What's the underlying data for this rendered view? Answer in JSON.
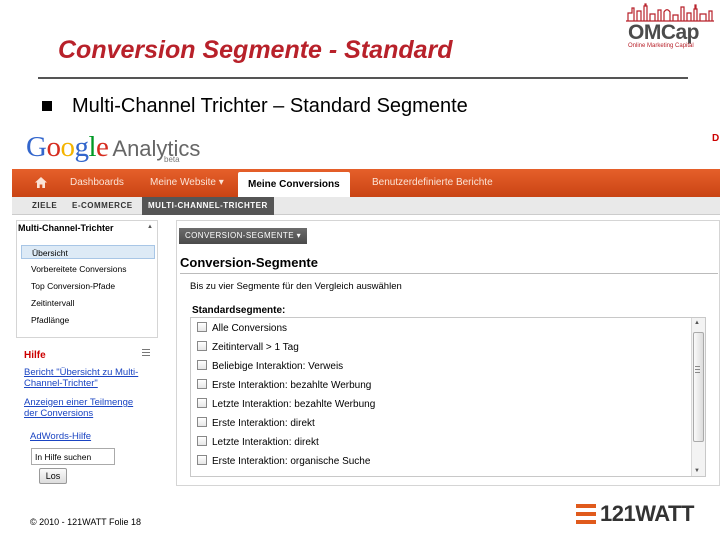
{
  "slide": {
    "title": "Conversion Segmente - Standard",
    "bullet": "Multi-Channel Trichter – Standard Segmente",
    "footer": "© 2010 - 121WATT Folie 18"
  },
  "logos": {
    "omcap_name": "OMCap",
    "omcap_tagline": "Online Marketing Capital",
    "watt": "121WATT"
  },
  "ga": {
    "google_letters": [
      "G",
      "o",
      "o",
      "g",
      "l",
      "e"
    ],
    "google_colors": [
      "#3366cc",
      "#d62d20",
      "#f4b400",
      "#3366cc",
      "#009925",
      "#d62d20"
    ],
    "analytics": "Analytics",
    "beta": "beta",
    "corner_mark": "D",
    "nav": {
      "home_icon": "home-icon",
      "dashboards": "Dashboards",
      "meine_website": "Meine Website ▾",
      "meine_conversions": "Meine Conversions",
      "benutzerdefinierte": "Benutzerdefinierte Berichte"
    },
    "subnav": {
      "ziele": "ZIELE",
      "ecommerce": "E-COMMERCE",
      "mct": "MULTI-CHANNEL-TRICHTER"
    },
    "sidebar": {
      "header": "Multi-Channel-Trichter",
      "collapse": "▲",
      "items": [
        "Übersicht",
        "Vorbereitete Conversions",
        "Top Conversion-Pfade",
        "Zeitintervall",
        "Pfadlänge"
      ]
    },
    "help": {
      "title": "Hilfe",
      "link1_line1": "Bericht \"Übersicht zu Multi-",
      "link1_line2": "Channel-Trichter\"",
      "link2_line1": "Anzeigen einer Teilmenge",
      "link2_line2": "der Conversions",
      "link3": "AdWords-Hilfe",
      "search_value": "In Hilfe suchen",
      "search_button": "Los"
    },
    "segments": {
      "dropdown": "CONVERSION-SEGMENTE ▾",
      "title": "Conversion-Segmente",
      "subtitle": "Bis zu vier Segmente für den Vergleich auswählen",
      "standard_label": "Standardsegmente:",
      "items": [
        "Alle Conversions",
        "Zeitintervall > 1 Tag",
        "Beliebige Interaktion: Verweis",
        "Erste Interaktion: bezahlte Werbung",
        "Letzte Interaktion: bezahlte Werbung",
        "Erste Interaktion: direkt",
        "Letzte Interaktion: direkt",
        "Erste Interaktion: organische Suche"
      ]
    }
  }
}
